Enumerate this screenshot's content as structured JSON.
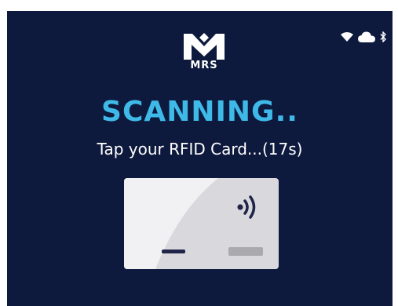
{
  "status_bar": {
    "icons": [
      "wifi-icon",
      "cloud-icon",
      "bluetooth-icon"
    ]
  },
  "logo": {
    "text": "MRS"
  },
  "scan": {
    "title": "SCANNING..",
    "instruction": "Tap your RFID Card...(17s)"
  },
  "card": {
    "icon": "contactless-icon"
  },
  "colors": {
    "background": "#0e1a3d",
    "accent": "#3fb9e8",
    "text": "#ffffff",
    "card": "#d9d9dd"
  }
}
